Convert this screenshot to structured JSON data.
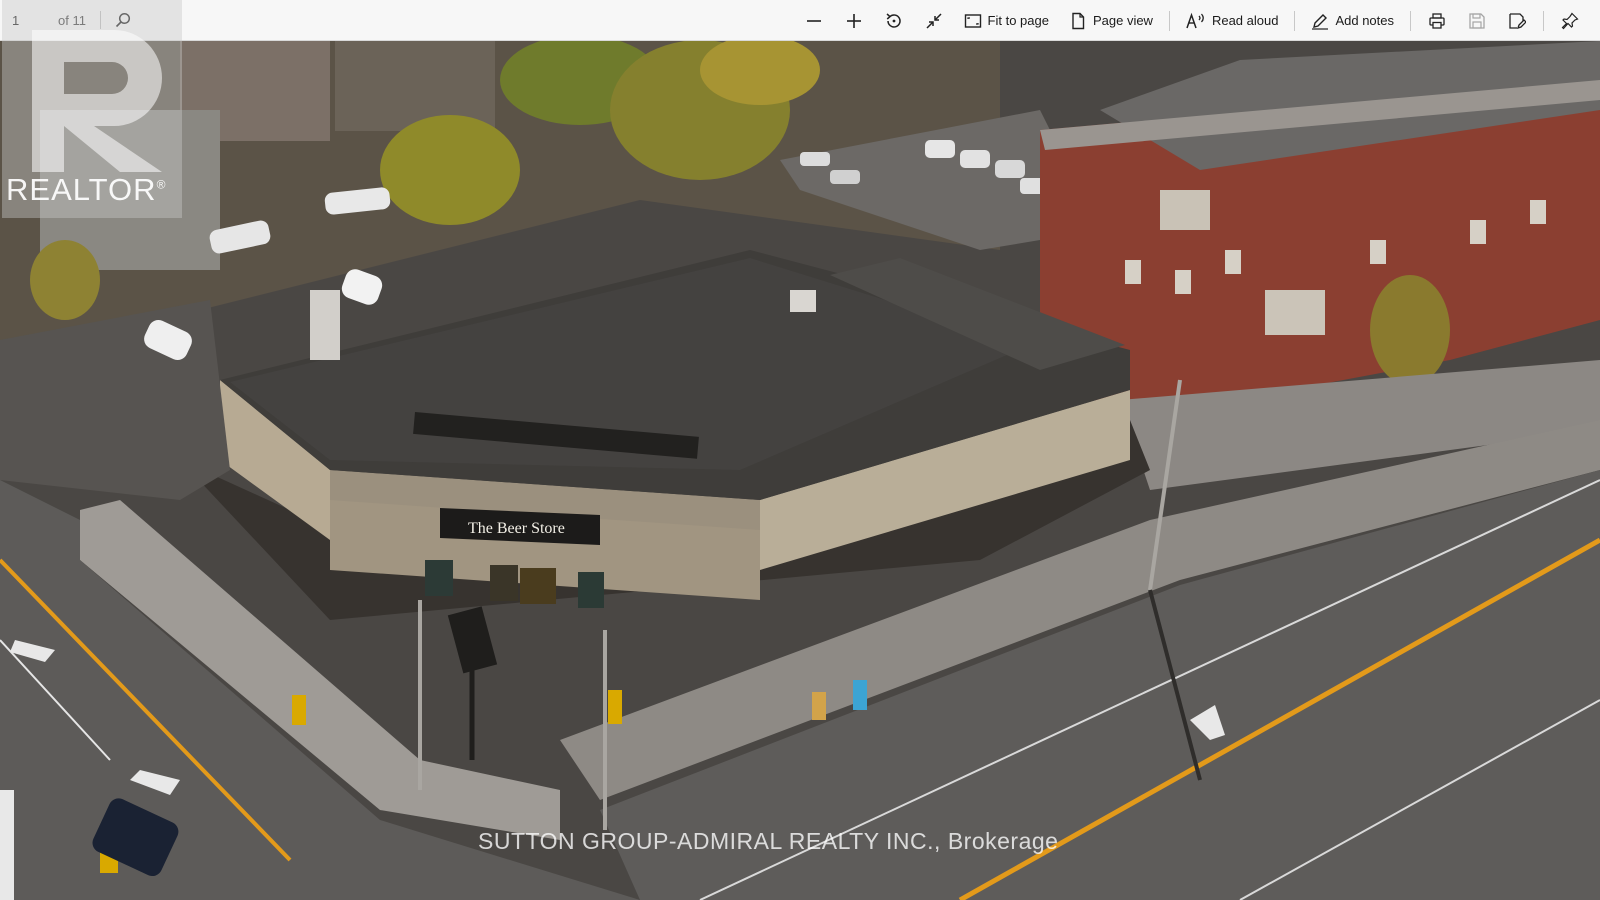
{
  "toolbar": {
    "page_current": "1",
    "page_total": "of 11",
    "buttons": {
      "zoom_out": "zoom-out-icon",
      "zoom_in": "zoom-in-icon",
      "rotate": "rotate-icon",
      "fullscreen": "collapse-icon",
      "fit_to_page": "Fit to page",
      "page_view": "Page view",
      "read_aloud": "Read aloud",
      "add_notes": "Add notes",
      "print": "print-icon",
      "save": "save-icon",
      "save_as": "save-as-icon",
      "pin": "pin-icon"
    }
  },
  "photo": {
    "store_sign": "The Beer Store"
  },
  "overlay": {
    "logo_text": "REALTOR",
    "logo_reg": "®",
    "watermark": "SUTTON GROUP-ADMIRAL REALTY INC., Brokerage"
  },
  "colors": {
    "toolbar_bg": "#f7f7f7",
    "road_marking": "#e39a1a"
  }
}
